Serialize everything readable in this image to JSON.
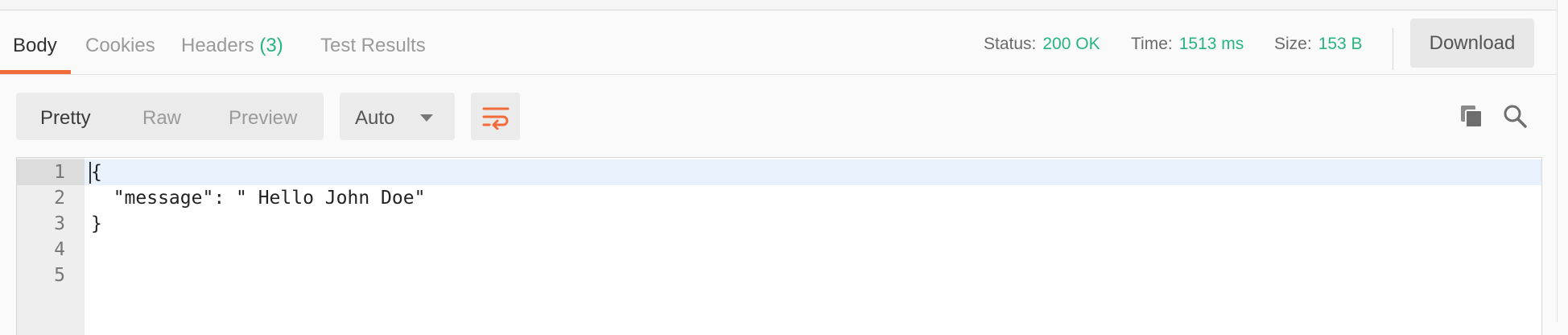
{
  "tabs": [
    {
      "label": "Body",
      "active": true
    },
    {
      "label": "Cookies",
      "active": false
    },
    {
      "label": "Headers",
      "count": "(3)",
      "active": false
    },
    {
      "label": "Test Results",
      "active": false
    }
  ],
  "response_meta": {
    "status_label": "Status:",
    "status_value": "200 OK",
    "time_label": "Time:",
    "time_value": "1513 ms",
    "size_label": "Size:",
    "size_value": "153 B"
  },
  "toolbar": {
    "download_label": "Download",
    "view_modes": [
      "Pretty",
      "Raw",
      "Preview"
    ],
    "active_view_mode": "Pretty",
    "format_selected": "Auto"
  },
  "icons": {
    "wrap": "wrap-lines-icon",
    "copy": "copy-icon",
    "search": "search-icon",
    "dropdown": "chevron-down-icon"
  },
  "colors": {
    "accent": "#f26b3a",
    "success": "#26b47f"
  },
  "editor": {
    "line_numbers": [
      "1",
      "2",
      "3",
      "4",
      "5"
    ],
    "lines": [
      "{",
      "  \"message\": \" Hello John Doe\"",
      "}",
      "",
      ""
    ]
  }
}
